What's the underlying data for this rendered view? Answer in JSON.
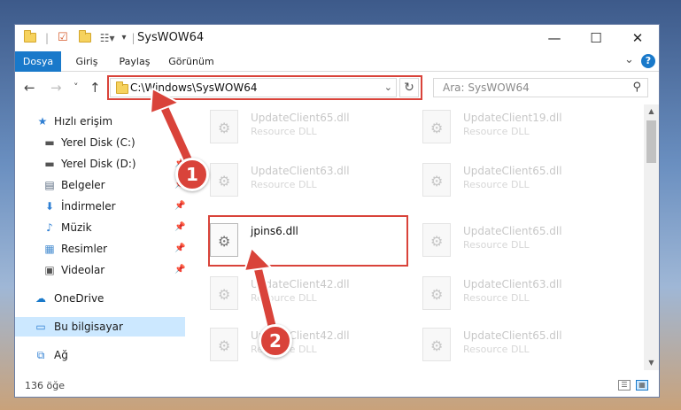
{
  "window": {
    "title": "SysWOW64",
    "minimize_glyph": "—",
    "maximize_glyph": "☐",
    "close_glyph": "✕"
  },
  "ribbon": {
    "tabs": [
      "Dosya",
      "Giriş",
      "Paylaş",
      "Görünüm"
    ],
    "active_tab": "Dosya",
    "help_glyph": "?",
    "collapse_glyph": "⌄"
  },
  "nav": {
    "back_glyph": "←",
    "forward_glyph": "→",
    "recent_glyph": "˅",
    "up_glyph": "↑",
    "address": "C:\\Windows\\SysWOW64",
    "dropdown_glyph": "⌄",
    "refresh_glyph": "↻",
    "search_placeholder": "Ara: SysWOW64",
    "search_glyph": "⚲"
  },
  "sidebar": {
    "items": [
      {
        "label": "Hızlı erişim",
        "icon": "star-icon",
        "glyph": "★",
        "color": "#2f7fd3",
        "pinned": false
      },
      {
        "label": "Yerel Disk (C:)",
        "icon": "drive-icon",
        "glyph": "▬",
        "color": "#555555",
        "pinned": true
      },
      {
        "label": "Yerel Disk (D:)",
        "icon": "drive-icon",
        "glyph": "▬",
        "color": "#555555",
        "pinned": true
      },
      {
        "label": "Belgeler",
        "icon": "document-icon",
        "glyph": "▤",
        "color": "#5a6b80",
        "pinned": true
      },
      {
        "label": "İndirmeler",
        "icon": "download-icon",
        "glyph": "⬇",
        "color": "#2f7fd3",
        "pinned": true
      },
      {
        "label": "Müzik",
        "icon": "music-icon",
        "glyph": "♪",
        "color": "#2f7fd3",
        "pinned": true
      },
      {
        "label": "Resimler",
        "icon": "pictures-icon",
        "glyph": "▦",
        "color": "#4a8fd1",
        "pinned": true
      },
      {
        "label": "Videolar",
        "icon": "video-icon",
        "glyph": "▣",
        "color": "#555555",
        "pinned": true
      },
      {
        "label": "OneDrive",
        "icon": "cloud-icon",
        "glyph": "☁",
        "color": "#1979ca",
        "pinned": false
      },
      {
        "label": "Bu bilgisayar",
        "icon": "computer-icon",
        "glyph": "▭",
        "color": "#2f7fd3",
        "pinned": false
      },
      {
        "label": "Ağ",
        "icon": "network-icon",
        "glyph": "⧉",
        "color": "#2f7fd3",
        "pinned": false
      }
    ],
    "selected": "Bu bilgisayar",
    "pin_glyph": "📌"
  },
  "files": [
    {
      "name": "UpdateClient65.dll",
      "type": "Resource DLL"
    },
    {
      "name": "UpdateClient19.dll",
      "type": "Resource DLL"
    },
    {
      "name": "UpdateClient63.dll",
      "type": "Resource DLL"
    },
    {
      "name": "UpdateClient65.dll",
      "type": "Resource DLL"
    },
    {
      "name": "jpins6.dll",
      "type": ""
    },
    {
      "name": "UpdateClient65.dll",
      "type": "Resource DLL"
    },
    {
      "name": "UpdateClient42.dll",
      "type": "Resource DLL"
    },
    {
      "name": "UpdateClient63.dll",
      "type": "Resource DLL"
    },
    {
      "name": "UpdateClient42.dll",
      "type": "Resource DLL"
    },
    {
      "name": "UpdateClient65.dll",
      "type": "Resource DLL"
    }
  ],
  "status": {
    "count": "136 öğe",
    "details_view_glyph": "☰",
    "icons_view_glyph": "▦"
  },
  "annotations": {
    "step1": "1",
    "step2": "2"
  },
  "colors": {
    "accent": "#1979ca",
    "highlight_red": "#d9433a",
    "selected_bg": "#cce8ff"
  }
}
